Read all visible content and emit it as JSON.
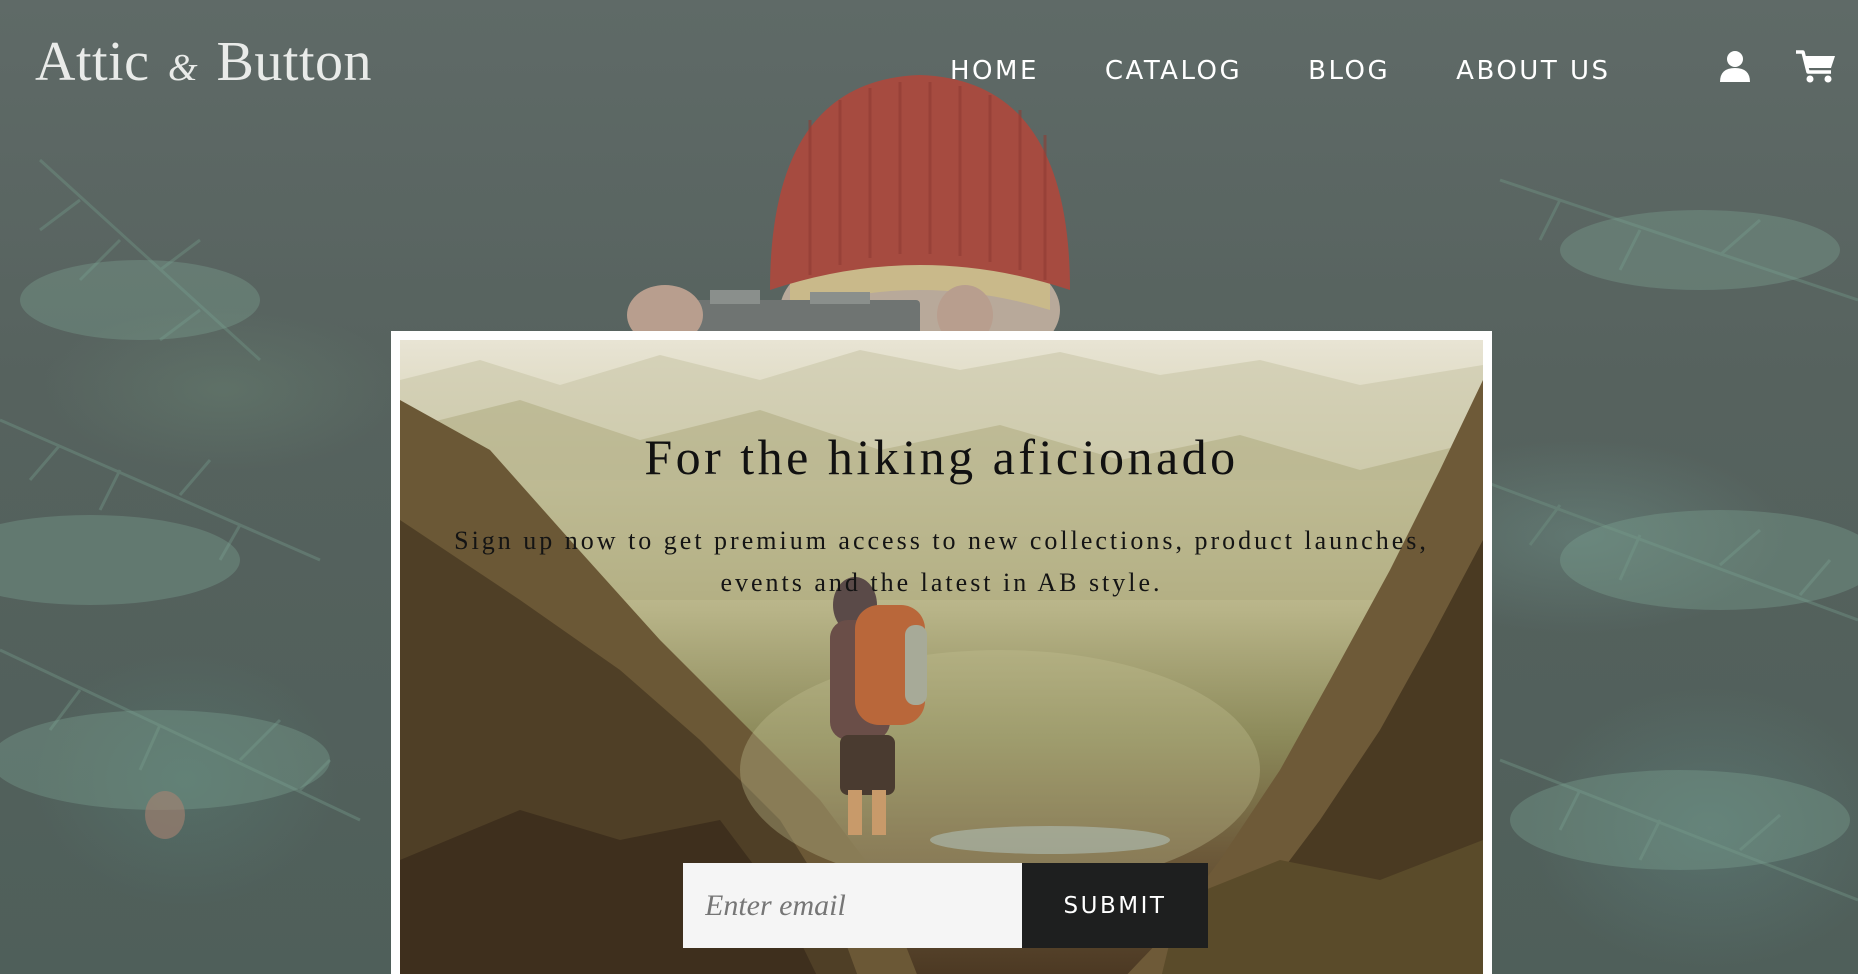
{
  "header": {
    "logo": {
      "part1": "Attic",
      "amp": "&",
      "part2": "Button"
    },
    "nav": [
      {
        "label": "HOME"
      },
      {
        "label": "CATALOG"
      },
      {
        "label": "BLOG"
      },
      {
        "label": "ABOUT US"
      }
    ],
    "icons": {
      "account": "account-icon",
      "cart": "cart-icon"
    }
  },
  "newsletter": {
    "title": "For the hiking aficionado",
    "subtitle": "Sign up now to get premium access to new collections, product launches, events and the latest in AB style.",
    "email_placeholder": "Enter email",
    "submit_label": "SUBMIT"
  },
  "colors": {
    "submit_bg": "#1e1f1f",
    "card_border": "#ffffff",
    "nav_text": "#ffffff"
  }
}
